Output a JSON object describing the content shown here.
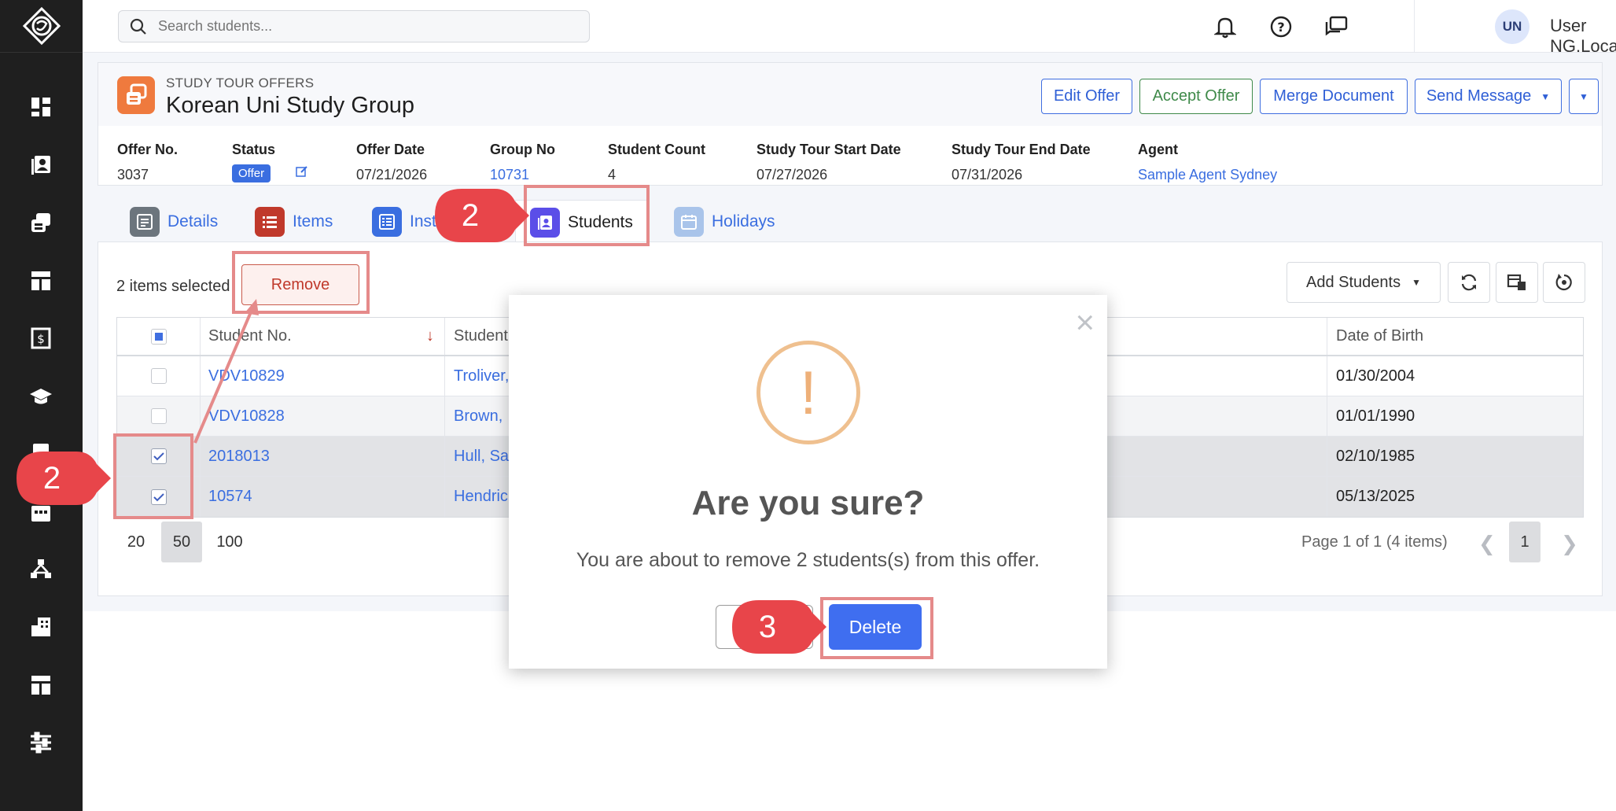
{
  "topbar": {
    "search_placeholder": "Search students...",
    "avatar_initials": "UN",
    "username": "User NG.Local"
  },
  "offer": {
    "kind": "STUDY TOUR OFFERS",
    "title": "Korean Uni Study Group",
    "actions": {
      "edit": "Edit Offer",
      "accept": "Accept Offer",
      "merge": "Merge Document",
      "send": "Send Message"
    },
    "fields": {
      "offer_no_label": "Offer No.",
      "offer_no": "3037",
      "status_label": "Status",
      "status": "Offer",
      "offer_date_label": "Offer Date",
      "offer_date": "07/21/2026",
      "group_no_label": "Group No",
      "group_no": "10731",
      "student_count_label": "Student Count",
      "student_count": "4",
      "start_label": "Study Tour Start Date",
      "start": "07/27/2026",
      "end_label": "Study Tour End Date",
      "end": "07/31/2026",
      "agent_label": "Agent",
      "agent": "Sample Agent Sydney"
    }
  },
  "tabs": {
    "details": "Details",
    "items": "Items",
    "inst": "Inst",
    "students": "Students",
    "holidays": "Holidays"
  },
  "students": {
    "selected_text": "2 items selected",
    "remove": "Remove",
    "add_students": "Add Students",
    "columns": {
      "student_no": "Student No.",
      "student": "Student",
      "dob": "Date of Birth"
    },
    "rows": [
      {
        "no": "VDV10829",
        "name": "Troliver,",
        "dob": "01/30/2004"
      },
      {
        "no": "VDV10828",
        "name": "Brown,",
        "dob": "01/01/1990"
      },
      {
        "no": "2018013",
        "name": "Hull, Sa",
        "dob": "02/10/1985"
      },
      {
        "no": "10574",
        "name": "Hendric",
        "dob": "05/13/2025"
      }
    ],
    "page_sizes": [
      "20",
      "50",
      "100"
    ],
    "page_info": "Page 1 of 1 (4 items)",
    "current_page": "1"
  },
  "modal": {
    "close": "×",
    "icon": "!",
    "title": "Are you sure?",
    "text": "You are about to remove 2 students(s) from this offer.",
    "delete": "Delete"
  },
  "callouts": {
    "tab": "2",
    "rows": "2",
    "delete": "3"
  },
  "colors": {
    "accent": "#3a6ee0",
    "callout": "#e8454a",
    "highlight": "#e58a8a",
    "warning": "#efc08f",
    "sidebar": "#1f1f1f"
  }
}
